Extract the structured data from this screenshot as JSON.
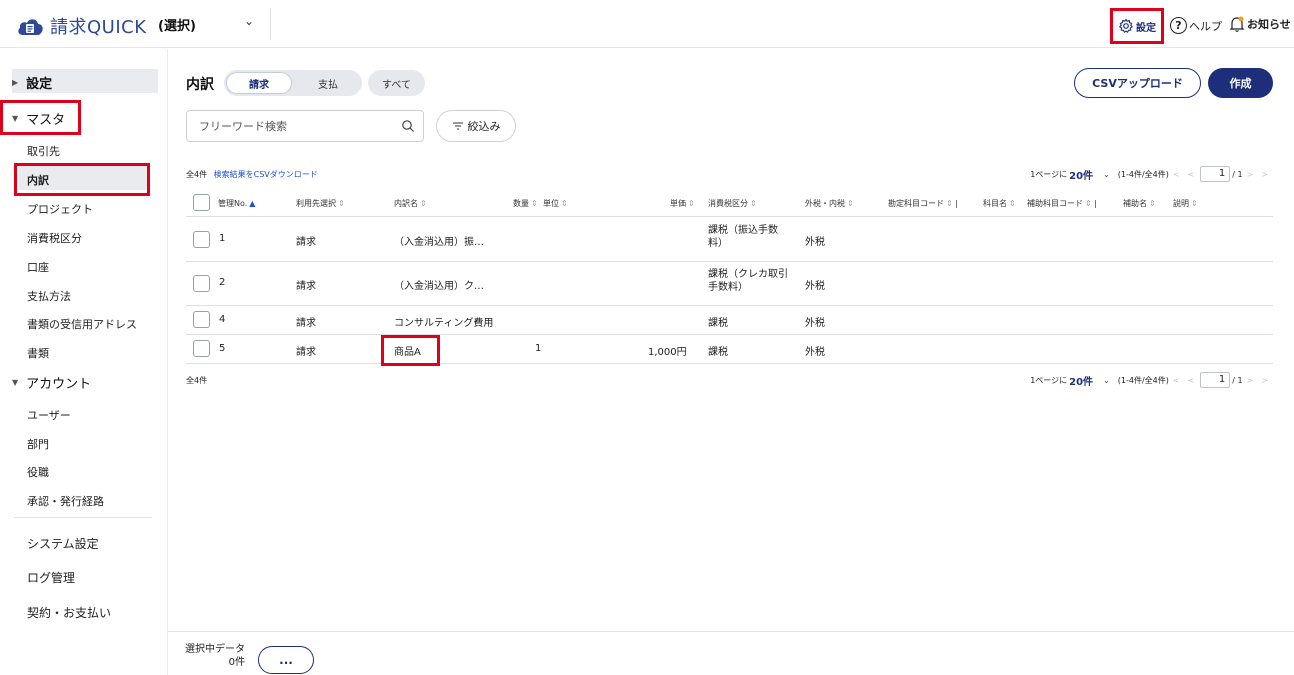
{
  "header": {
    "app_name": "請求QUICK",
    "org_select": "(選択)",
    "settings_label": "設定",
    "help_label": "ヘルプ",
    "notice_label": "お知らせ"
  },
  "sidebar": {
    "settings_label": "設定",
    "master_label": "マスタ",
    "master_items": [
      "取引先",
      "内訳",
      "プロジェクト",
      "消費税区分",
      "口座",
      "支払方法",
      "書類の受信用アドレス",
      "書類"
    ],
    "account_label": "アカウント",
    "account_items": [
      "ユーザー",
      "部門",
      "役職",
      "承認・発行経路"
    ],
    "bottom_items": [
      "システム設定",
      "ログ管理",
      "契約・お支払い"
    ]
  },
  "main": {
    "title": "内訳",
    "tabs": [
      "請求",
      "支払",
      "すべて"
    ],
    "csv_upload_label": "CSVアップロード",
    "create_label": "作成",
    "search_placeholder": "フリーワード検索",
    "filter_label": "絞込み",
    "count_label": "全4件",
    "csv_download_link": "検索結果をCSVダウンロード",
    "bottom_count": "全4件"
  },
  "pager": {
    "per_page_prefix": "1ページに",
    "per_page_value": "20件",
    "range": "(1-4件/全4件)",
    "current_page": "1",
    "total_pages": "/ 1"
  },
  "table": {
    "columns": [
      "管理No.",
      "利用先選択",
      "内訳名",
      "数量",
      "単位",
      "単価",
      "消費税区分",
      "外税・内税",
      "勘定科目コード",
      "科目名",
      "補助科目コード",
      "補助名",
      "説明"
    ],
    "rows": [
      {
        "no": "1",
        "usage": "請求",
        "name": "（入金消込用）振…",
        "qty": "",
        "unit": "",
        "price": "",
        "tax": "課税（振込手数料）",
        "tax_type": "外税"
      },
      {
        "no": "2",
        "usage": "請求",
        "name": "（入金消込用）ク…",
        "qty": "",
        "unit": "",
        "price": "",
        "tax": "課税（クレカ取引手数料）",
        "tax_type": "外税"
      },
      {
        "no": "4",
        "usage": "請求",
        "name": "コンサルティング費用",
        "qty": "",
        "unit": "",
        "price": "",
        "tax": "課税",
        "tax_type": "外税"
      },
      {
        "no": "5",
        "usage": "請求",
        "name": "商品A",
        "qty": "1",
        "unit": "",
        "price": "1,000円",
        "tax": "課税",
        "tax_type": "外税"
      }
    ]
  },
  "footer": {
    "selected_label": "選択中データ",
    "selected_count": "0件",
    "more_label": "..."
  },
  "colors": {
    "brand": "#1d2f7a",
    "highlight": "#e0001b",
    "link": "#1d4ed8"
  }
}
